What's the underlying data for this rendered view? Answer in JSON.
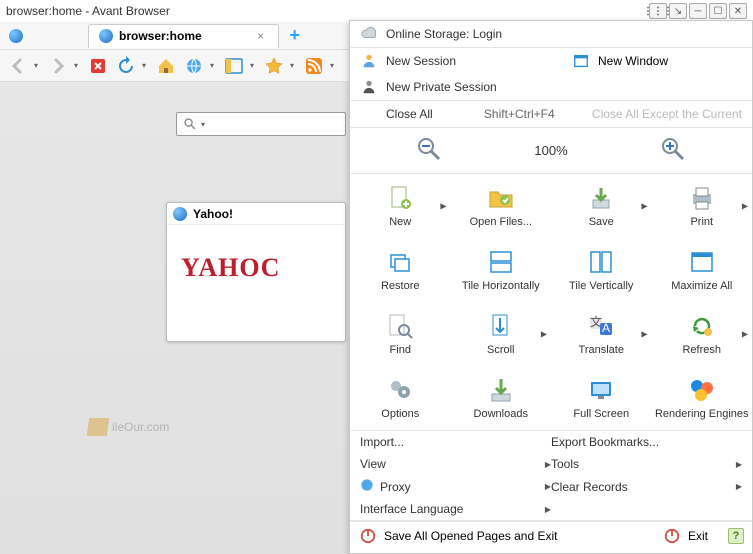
{
  "window": {
    "title": "browser:home - Avant Browser"
  },
  "tab": {
    "label": "browser:home"
  },
  "yahoo": {
    "header": "Yahoo!",
    "logo": "YAHOC"
  },
  "watermark": {
    "text": "ileOur.com"
  },
  "menu": {
    "online_storage": "Online Storage: Login",
    "new_session": "New Session",
    "new_window": "New Window",
    "new_private": "New Private Session",
    "close_all": "Close All",
    "close_all_shortcut": "Shift+Ctrl+F4",
    "close_all_except": "Close All Except the Current",
    "zoom_pct": "100%",
    "grid": {
      "new": "New",
      "open_files": "Open Files...",
      "save": "Save",
      "print": "Print",
      "restore": "Restore",
      "tile_h": "Tile Horizontally",
      "tile_v": "Tile Vertically",
      "maximize": "Maximize All",
      "find": "Find",
      "scroll": "Scroll",
      "translate": "Translate",
      "refresh": "Refresh",
      "options": "Options",
      "downloads": "Downloads",
      "fullscreen": "Full Screen",
      "engines": "Rendering Engines"
    },
    "rows": {
      "import": "Import...",
      "export_bookmarks": "Export Bookmarks...",
      "view": "View",
      "tools": "Tools",
      "proxy": "Proxy",
      "clear": "Clear Records",
      "lang": "Interface Language"
    },
    "exit": {
      "save_exit": "Save All Opened Pages and Exit",
      "exit": "Exit"
    }
  }
}
